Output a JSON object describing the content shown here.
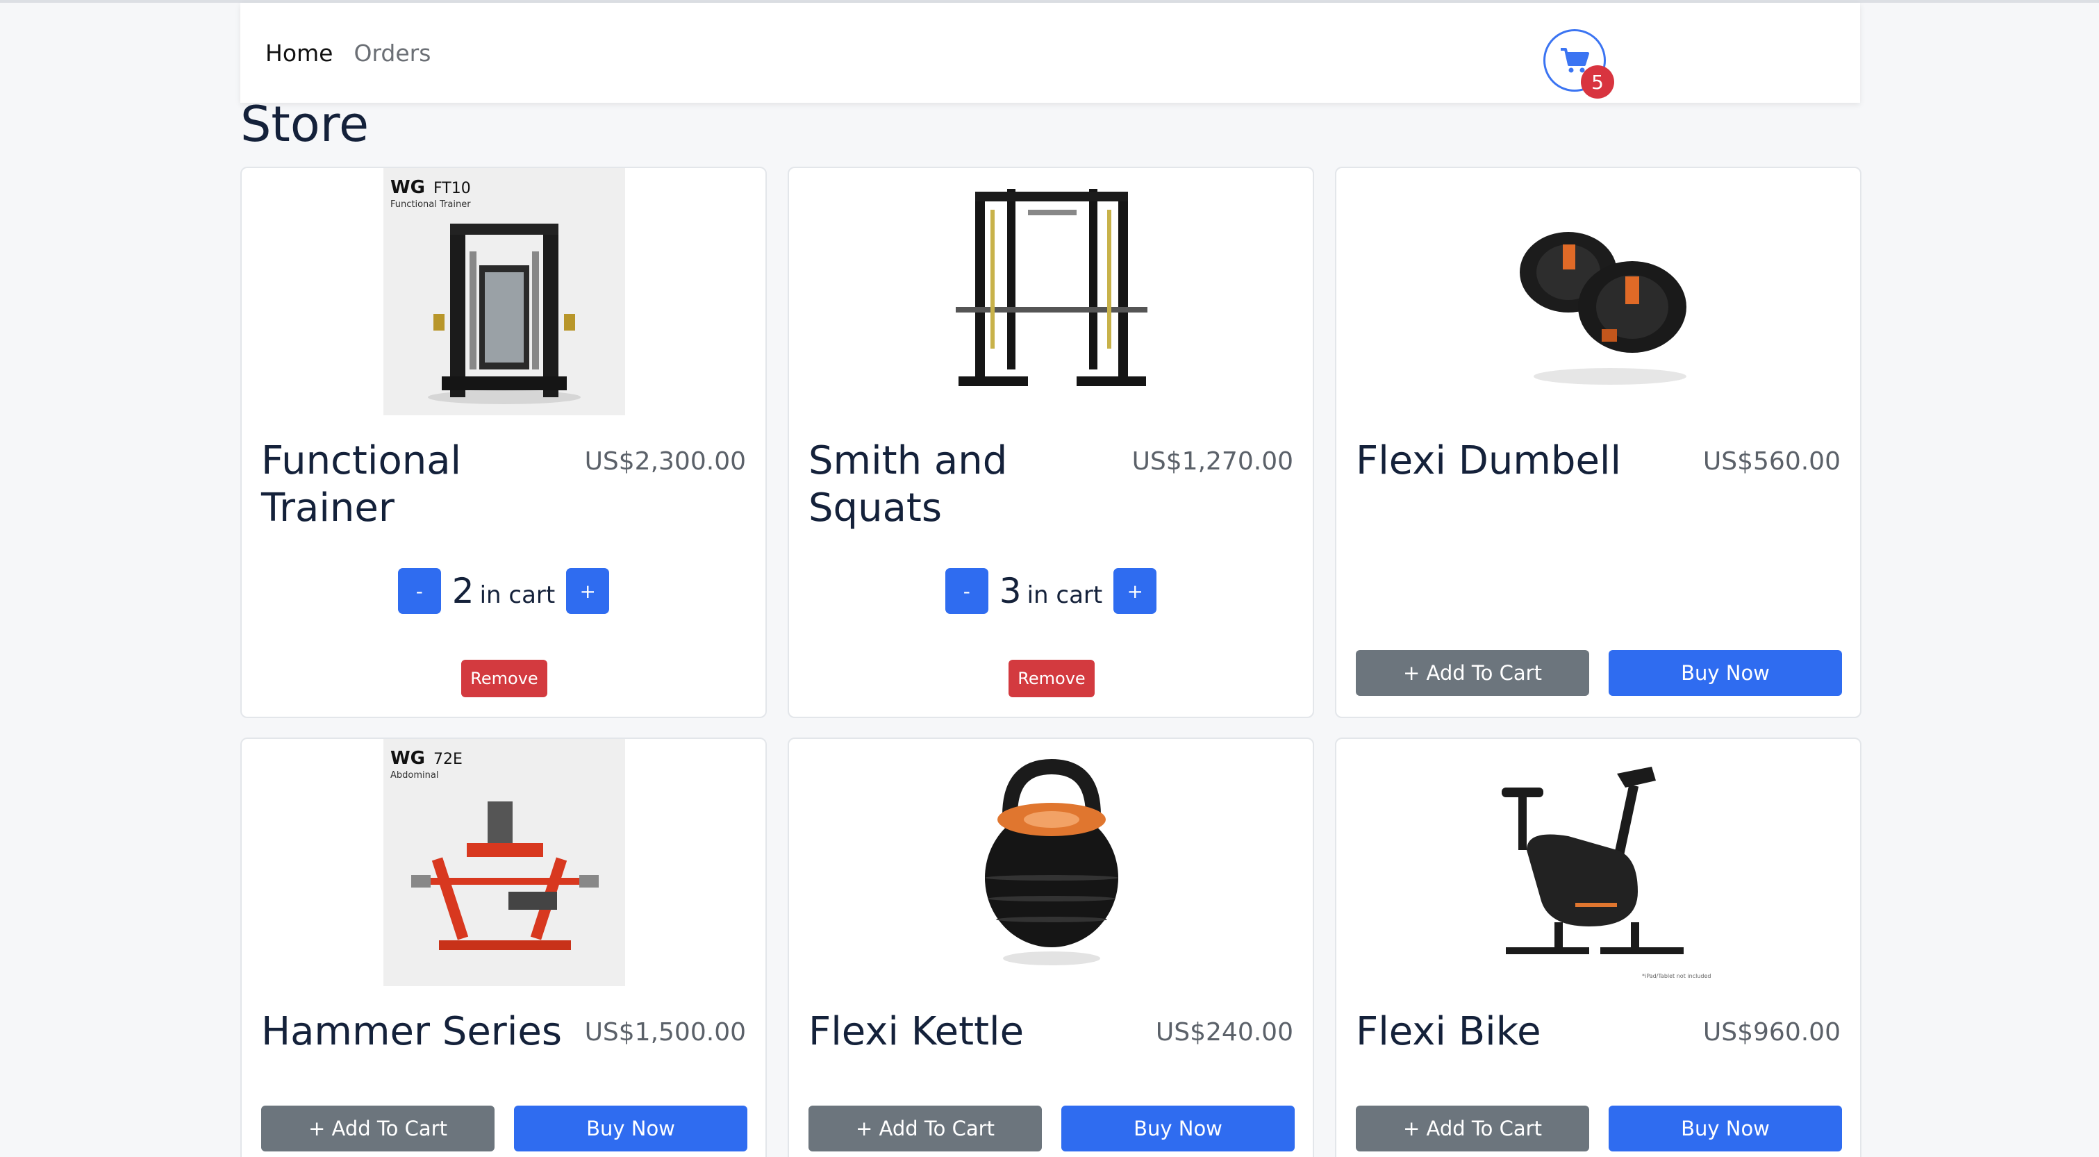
{
  "nav": {
    "home": "Home",
    "orders": "Orders",
    "cart_count": "5"
  },
  "page_title": "Store",
  "colors": {
    "primary": "#2f6cf0",
    "secondary": "#6c757d",
    "danger": "#d33a3f",
    "badge": "#d8343f"
  },
  "products": [
    {
      "name": "Functional Trainer",
      "price": "US$2,300.00",
      "qty": "2",
      "in_cart_label": "in cart",
      "minus": "-",
      "plus": "+",
      "remove": "Remove",
      "image_brand": "WG",
      "image_model": "FT10",
      "image_sub": "Functional Trainer"
    },
    {
      "name": "Smith and Squats",
      "price": "US$1,270.00",
      "qty": "3",
      "in_cart_label": "in cart",
      "minus": "-",
      "plus": "+",
      "remove": "Remove"
    },
    {
      "name": "Flexi Dumbell",
      "price": "US$560.00",
      "add": "+ Add To Cart",
      "buy": "Buy Now"
    },
    {
      "name": "Hammer Series",
      "price": "US$1,500.00",
      "add": "+ Add To Cart",
      "buy": "Buy Now",
      "image_brand": "WG",
      "image_model": "72E",
      "image_sub": "Abdominal"
    },
    {
      "name": "Flexi Kettle",
      "price": "US$240.00",
      "add": "+ Add To Cart",
      "buy": "Buy Now"
    },
    {
      "name": "Flexi Bike",
      "price": "US$960.00",
      "add": "+ Add To Cart",
      "buy": "Buy Now",
      "image_note": "*iPad/Tablet not included"
    }
  ]
}
